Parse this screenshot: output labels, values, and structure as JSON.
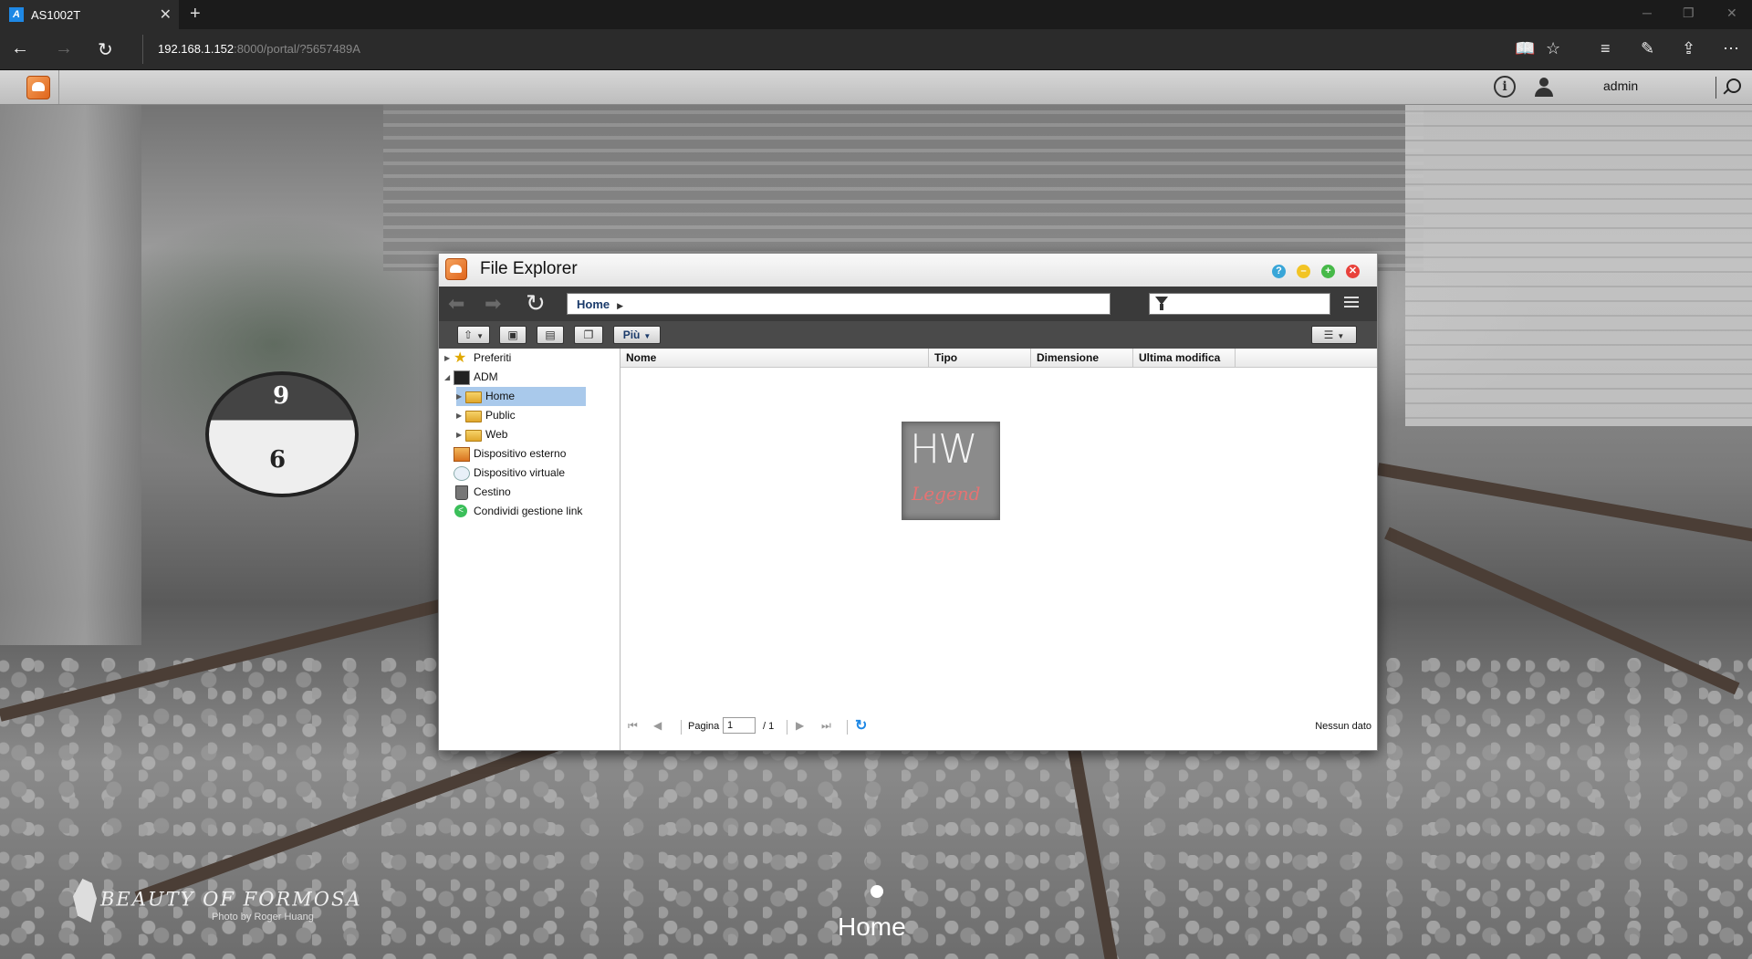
{
  "browser": {
    "tab_title": "AS1002T",
    "favicon_letter": "A",
    "url_host": "192.168.1.152",
    "url_rest": ":8000/portal/?5657489A"
  },
  "nas": {
    "user": "admin"
  },
  "explorer": {
    "title": "File Explorer",
    "path": "Home",
    "toolbar_more": "Più",
    "tree": [
      {
        "label": "Preferiti"
      },
      {
        "label": "ADM"
      },
      {
        "label": "Home"
      },
      {
        "label": "Public"
      },
      {
        "label": "Web"
      },
      {
        "label": "Dispositivo esterno"
      },
      {
        "label": "Dispositivo virtuale"
      },
      {
        "label": "Cestino"
      },
      {
        "label": "Condividi gestione link"
      }
    ],
    "columns": [
      "Nome",
      "Tipo",
      "Dimensione",
      "Ultima modifica"
    ],
    "pager": {
      "page_label": "Pagina",
      "page_value": "1",
      "of_total": "/ 1",
      "status": "Nessun dato"
    }
  },
  "watermark": {
    "hw": "HW",
    "legend": "Legend"
  },
  "wallpaper": {
    "brand": "BEAUTY OF FORMOSA",
    "photo_credit": "Photo by Roger Huang",
    "caption": "Home"
  },
  "colors": {
    "selection": "#a9c9eb",
    "accent_blue": "#1e88e5",
    "brand_orange": "#e0651b"
  }
}
